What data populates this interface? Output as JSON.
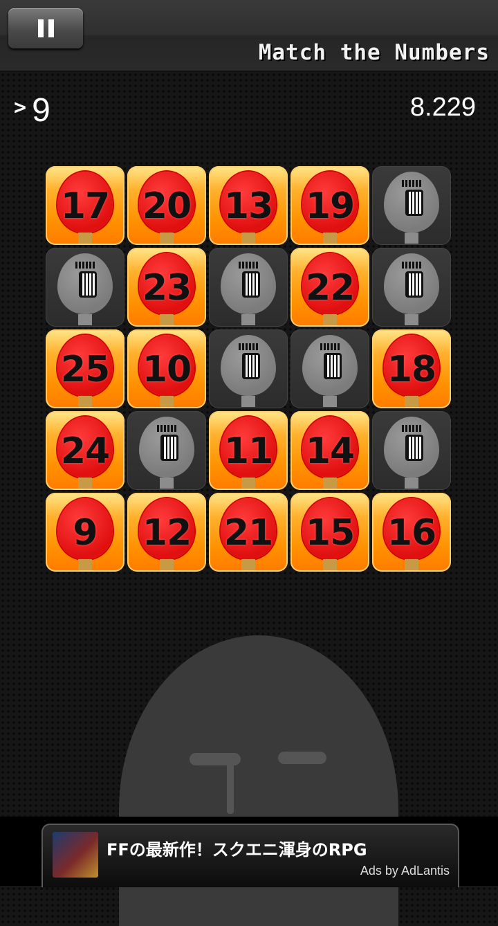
{
  "header": {
    "title": "Match the Numbers",
    "pause_icon": "pause-icon"
  },
  "status": {
    "target_prefix": ">",
    "target_value": "9",
    "timer": "8.229"
  },
  "tiles": [
    {
      "state": "active",
      "number": "17"
    },
    {
      "state": "active",
      "number": "20"
    },
    {
      "state": "active",
      "number": "13"
    },
    {
      "state": "active",
      "number": "19"
    },
    {
      "state": "dead",
      "number": ""
    },
    {
      "state": "dead",
      "number": ""
    },
    {
      "state": "active",
      "number": "23"
    },
    {
      "state": "dead",
      "number": ""
    },
    {
      "state": "active",
      "number": "22"
    },
    {
      "state": "dead",
      "number": ""
    },
    {
      "state": "active",
      "number": "25"
    },
    {
      "state": "active",
      "number": "10"
    },
    {
      "state": "dead",
      "number": ""
    },
    {
      "state": "dead",
      "number": ""
    },
    {
      "state": "active",
      "number": "18"
    },
    {
      "state": "active",
      "number": "24"
    },
    {
      "state": "dead",
      "number": ""
    },
    {
      "state": "active",
      "number": "11"
    },
    {
      "state": "active",
      "number": "14"
    },
    {
      "state": "dead",
      "number": ""
    },
    {
      "state": "active",
      "number": "9"
    },
    {
      "state": "active",
      "number": "12"
    },
    {
      "state": "active",
      "number": "21"
    },
    {
      "state": "active",
      "number": "15"
    },
    {
      "state": "active",
      "number": "16"
    }
  ],
  "ad": {
    "text": "FFの最新作！スクエニ渾身のRPG",
    "credit": "Ads by AdLantis"
  }
}
